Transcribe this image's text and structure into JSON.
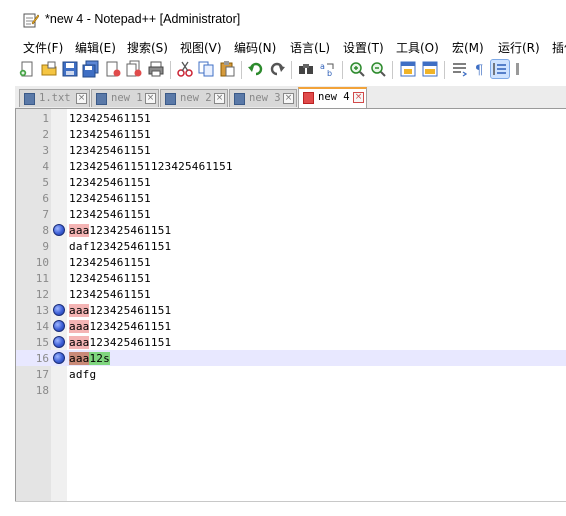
{
  "window": {
    "title": "*new 4 - Notepad++ [Administrator]"
  },
  "menu": [
    "文件(F)",
    "编辑(E)",
    "搜索(S)",
    "视图(V)",
    "编码(N)",
    "语言(L)",
    "设置(T)",
    "工具(O)",
    "宏(M)",
    "运行(R)",
    "插件"
  ],
  "toolbar_icons": [
    "new-file-icon",
    "open-file-icon",
    "save-icon",
    "save-all-icon",
    "close-icon",
    "close-all-icon",
    "print-icon",
    "cut-icon",
    "copy-icon",
    "paste-icon",
    "undo-icon",
    "redo-icon",
    "find-icon",
    "replace-icon",
    "zoom-in-icon",
    "zoom-out-icon",
    "sync-vertical-icon",
    "sync-horizontal-icon",
    "word-wrap-icon",
    "show-all-chars-icon",
    "indent-guide-icon"
  ],
  "tabs": [
    {
      "label": "1.txt",
      "active": false
    },
    {
      "label": "new 1",
      "active": false
    },
    {
      "label": "new 2",
      "active": false
    },
    {
      "label": "new 3",
      "active": false
    },
    {
      "label": "new 4",
      "active": true
    }
  ],
  "editor": {
    "lines": [
      {
        "num": "1",
        "prefix": "",
        "text": "123425461151",
        "bookmark": false
      },
      {
        "num": "2",
        "prefix": "",
        "text": "123425461151",
        "bookmark": false
      },
      {
        "num": "3",
        "prefix": "",
        "text": "123425461151",
        "bookmark": false
      },
      {
        "num": "4",
        "prefix": "",
        "text": "123425461151123425461151",
        "bookmark": false
      },
      {
        "num": "5",
        "prefix": "",
        "text": "123425461151",
        "bookmark": false
      },
      {
        "num": "6",
        "prefix": "",
        "text": "123425461151",
        "bookmark": false
      },
      {
        "num": "7",
        "prefix": "",
        "text": "123425461151",
        "bookmark": false
      },
      {
        "num": "8",
        "prefix": "aaa",
        "text": "123425461151",
        "bookmark": true
      },
      {
        "num": "9",
        "prefix": "",
        "text": "daf123425461151",
        "bookmark": false
      },
      {
        "num": "10",
        "prefix": "",
        "text": "123425461151",
        "bookmark": false
      },
      {
        "num": "11",
        "prefix": "",
        "text": "123425461151",
        "bookmark": false
      },
      {
        "num": "12",
        "prefix": "",
        "text": "123425461151",
        "bookmark": false
      },
      {
        "num": "13",
        "prefix": "aaa",
        "text": "123425461151",
        "bookmark": true
      },
      {
        "num": "14",
        "prefix": "aaa",
        "text": "123425461151",
        "bookmark": true
      },
      {
        "num": "15",
        "prefix": "aaa",
        "text": "123425461151",
        "bookmark": true
      },
      {
        "num": "16",
        "prefix": "aaa",
        "text": "12s",
        "bookmark": true,
        "current": true
      },
      {
        "num": "17",
        "prefix": "",
        "text": "adfg",
        "bookmark": false
      },
      {
        "num": "18",
        "prefix": "",
        "text": "",
        "bookmark": false
      }
    ]
  },
  "colors": {
    "bookmark": "#3d5fd6",
    "tab_accent": "#f2a33a",
    "current_line": "#e8e8ff",
    "match_highlight": "#f4b4b4",
    "selection_green": "#7fd67f"
  }
}
